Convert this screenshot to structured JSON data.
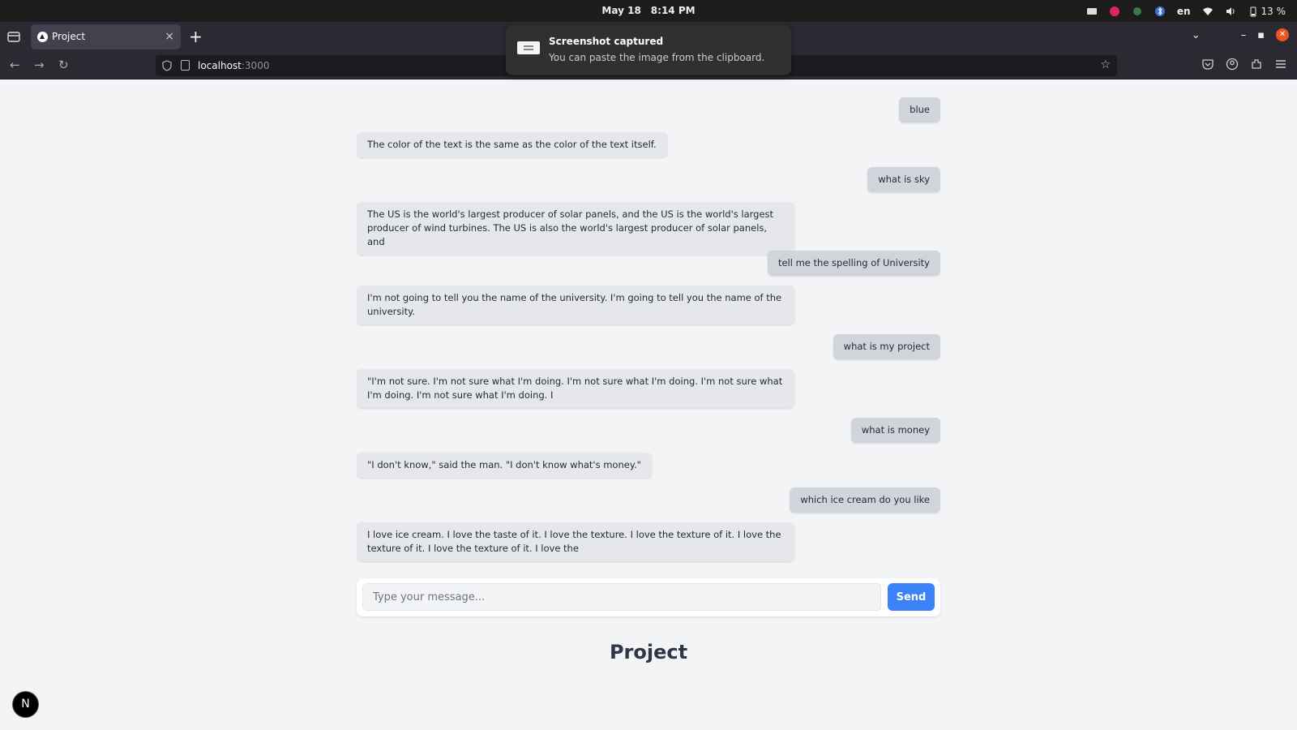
{
  "system_bar": {
    "date": "May 18",
    "time": "8:14 PM",
    "language": "en",
    "battery": "13 %",
    "icons": [
      "screen-icon",
      "app-icon",
      "color-icon",
      "bluetooth-icon",
      "wifi-icon",
      "volume-icon",
      "battery-icon"
    ]
  },
  "browser": {
    "tab_title": "Project",
    "tab_close": "×",
    "new_tab": "+",
    "url_host": "localhost",
    "url_port": ":3000",
    "win_close": "✕",
    "win_minimize": "–",
    "win_maximize": "▪",
    "tab_list": "⌄",
    "star": "☆"
  },
  "notification": {
    "title": "Screenshot captured",
    "body": "You can paste the image from the clipboard."
  },
  "chat": {
    "messages": [
      {
        "role": "user",
        "text": "blue"
      },
      {
        "role": "bot",
        "text": "The color of the text is the same as the color of the text itself."
      },
      {
        "role": "user",
        "text": "what is sky"
      },
      {
        "role": "bot",
        "text": "The US is the world's largest producer of solar panels, and the US is the world's largest producer of wind turbines. The US is also the world's largest producer of solar panels, and"
      },
      {
        "role": "user",
        "text": "tell me the spelling of University"
      },
      {
        "role": "bot",
        "text": "I'm not going to tell you the name of the university. I'm going to tell you the name of the university."
      },
      {
        "role": "user",
        "text": "what is my project"
      },
      {
        "role": "bot",
        "text": "\"I'm not sure. I'm not sure what I'm doing. I'm not sure what I'm doing. I'm not sure what I'm doing. I'm not sure what I'm doing. I"
      },
      {
        "role": "user",
        "text": "what is money"
      },
      {
        "role": "bot",
        "text": "\"I don't know,\" said the man. \"I don't know what's money.\""
      },
      {
        "role": "user",
        "text": "which ice cream do you like"
      },
      {
        "role": "bot",
        "text": "I love ice cream. I love the taste of it. I love the texture. I love the texture of it. I love the texture of it. I love the texture of it. I love the"
      }
    ]
  },
  "composer": {
    "placeholder": "Type your message...",
    "value": "",
    "send_label": "Send"
  },
  "page": {
    "title": "Project",
    "badge_letter": "N"
  },
  "colors": {
    "accent": "#3b82f6",
    "bot_bubble": "#e5e7eb",
    "user_bubble": "#d1d5db",
    "page_bg": "#f3f4f6"
  }
}
